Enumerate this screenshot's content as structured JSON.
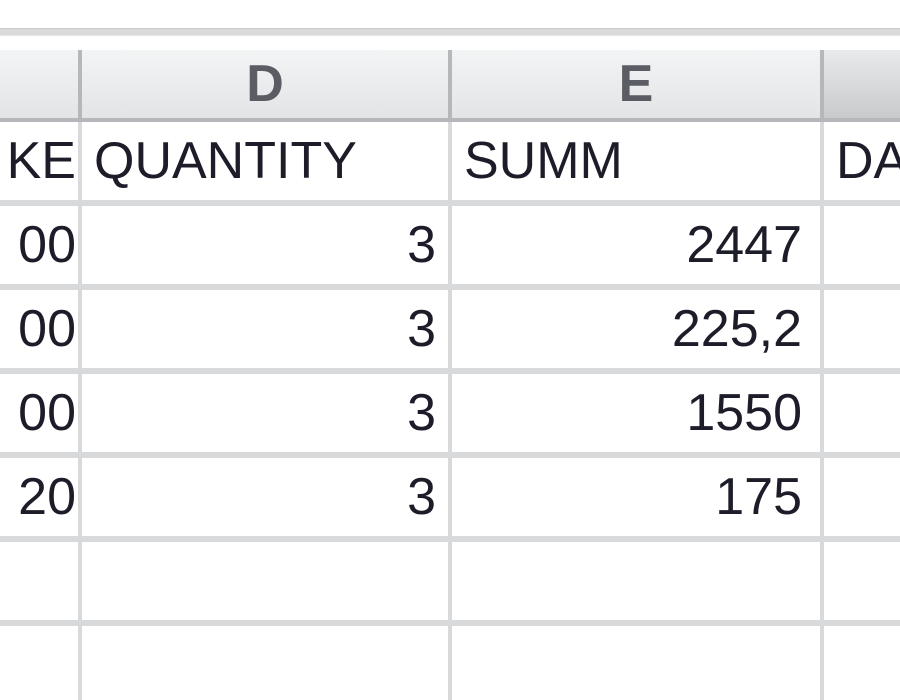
{
  "column_headers": {
    "c": "",
    "d": "D",
    "e": "E",
    "f": ""
  },
  "rows": [
    {
      "c": "KE",
      "d": "QUANTITY",
      "e": "SUMM",
      "f": "DA"
    },
    {
      "c": "00",
      "d": "3",
      "e": "2447",
      "f": ""
    },
    {
      "c": "00",
      "d": "3",
      "e": "225,2",
      "f": ""
    },
    {
      "c": "00",
      "d": "3",
      "e": "1550",
      "f": ""
    },
    {
      "c": "20",
      "d": "3",
      "e": "175",
      "f": ""
    },
    {
      "c": "",
      "d": "",
      "e": "",
      "f": ""
    },
    {
      "c": "",
      "d": "",
      "e": "",
      "f": ""
    }
  ]
}
